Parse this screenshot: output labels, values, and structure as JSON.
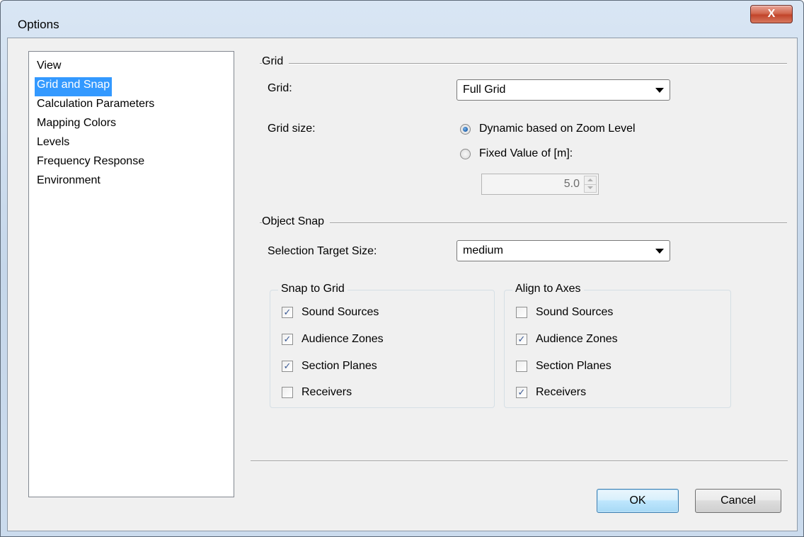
{
  "window": {
    "title": "Options",
    "close_label": "X"
  },
  "nav": {
    "items": [
      {
        "label": "View",
        "selected": false
      },
      {
        "label": "Grid and Snap",
        "selected": true
      },
      {
        "label": "Calculation Parameters",
        "selected": false
      },
      {
        "label": "Mapping Colors",
        "selected": false
      },
      {
        "label": "Levels",
        "selected": false
      },
      {
        "label": "Frequency Response",
        "selected": false
      },
      {
        "label": "Environment",
        "selected": false
      }
    ]
  },
  "grid_section": {
    "title": "Grid",
    "grid_label": "Grid:",
    "grid_value": "Full Grid",
    "grid_size_label": "Grid size:",
    "radio_dynamic": {
      "label": "Dynamic based on Zoom Level",
      "checked": true
    },
    "radio_fixed": {
      "label": "Fixed Value of [m]:",
      "checked": false
    },
    "fixed_value": "5.0"
  },
  "object_snap": {
    "title": "Object Snap",
    "target_label": "Selection Target Size:",
    "target_value": "medium",
    "snap_to_grid": {
      "title": "Snap to Grid",
      "items": [
        {
          "label": "Sound Sources",
          "checked": true
        },
        {
          "label": "Audience Zones",
          "checked": true
        },
        {
          "label": "Section Planes",
          "checked": true
        },
        {
          "label": "Receivers",
          "checked": false
        }
      ]
    },
    "align_to_axes": {
      "title": "Align to Axes",
      "items": [
        {
          "label": "Sound Sources",
          "checked": false
        },
        {
          "label": "Audience Zones",
          "checked": true
        },
        {
          "label": "Section Planes",
          "checked": false
        },
        {
          "label": "Receivers",
          "checked": true
        }
      ]
    }
  },
  "buttons": {
    "ok": "OK",
    "cancel": "Cancel"
  },
  "check_glyph": "✓"
}
